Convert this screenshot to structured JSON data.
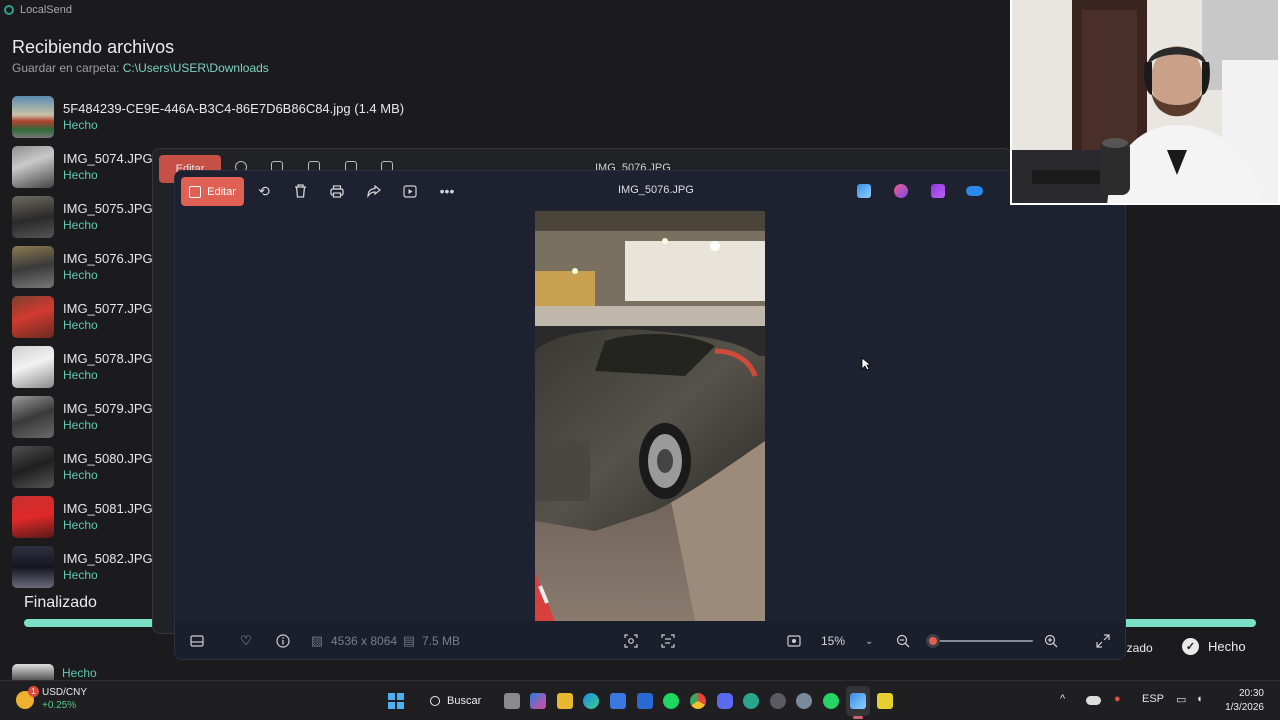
{
  "localsend": {
    "app_title": "LocalSend",
    "heading": "Recibiendo archivos",
    "save_label": "Guardar en carpeta:",
    "save_path": "C:\\Users\\USER\\Downloads",
    "files": [
      {
        "name": "5F484239-CE9E-446A-B3C4-86E7D6B86C84.jpg (1.4 MB)",
        "status": "Hecho"
      },
      {
        "name": "IMG_5074.JPG",
        "status": "Hecho"
      },
      {
        "name": "IMG_5075.JPG",
        "status": "Hecho"
      },
      {
        "name": "IMG_5076.JPG",
        "status": "Hecho"
      },
      {
        "name": "IMG_5077.JPG",
        "status": "Hecho"
      },
      {
        "name": "IMG_5078.JPG",
        "status": "Hecho"
      },
      {
        "name": "IMG_5079.JPG",
        "status": "Hecho"
      },
      {
        "name": "IMG_5080.JPG",
        "status": "Hecho"
      },
      {
        "name": "IMG_5081.JPG",
        "status": "Hecho"
      },
      {
        "name": "IMG_5082.JPG",
        "status": "Hecho"
      }
    ],
    "last_status": "Hecho",
    "finished_label": "Finalizado",
    "progress": 1.0,
    "button_finalizado_partial": "nzado",
    "button_done": "Hecho"
  },
  "photos_back": {
    "edit_label": "Editar",
    "title": "IMG_5076.JPG"
  },
  "photos": {
    "edit_label": "Editar",
    "title": "IMG_5076.JPG",
    "toolbar_icons": [
      "rotate-icon",
      "delete-icon",
      "print-icon",
      "share-icon",
      "slideshow-icon",
      "more-icon"
    ],
    "dimensions": "4536 x 8064",
    "file_size": "7.5 MB",
    "zoom": "15%",
    "zoom_level": 0.0
  },
  "taskbar": {
    "widget_name": "USD/CNY",
    "widget_change": "+0.25%",
    "widget_badge": "1",
    "search_label": "Buscar",
    "language": "ESP",
    "time": "20:30",
    "date": "1/3/2026"
  },
  "colors": {
    "accent_teal": "#5ec8b2",
    "edit_red": "#e06153",
    "progress": "#7ce0c6"
  }
}
